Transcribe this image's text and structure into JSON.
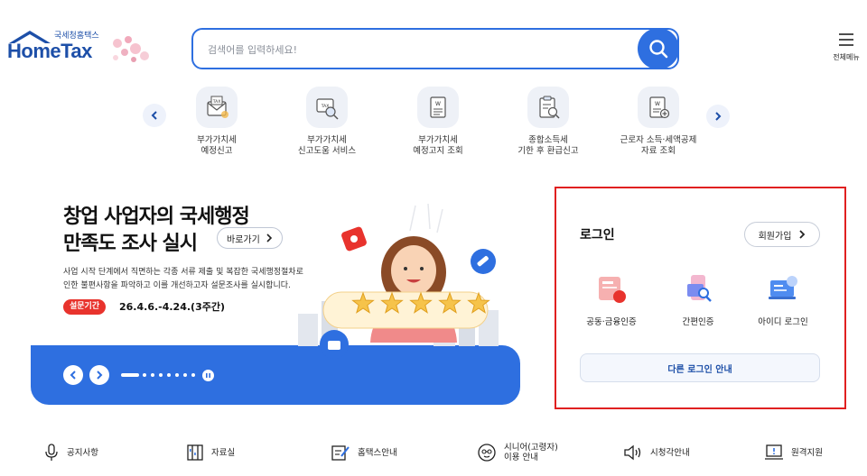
{
  "header": {
    "brand": "HomeTax",
    "brand_sub": "국세청홈택스",
    "search_placeholder": "검색어를 입력하세요!",
    "menu_label": "전체메뉴"
  },
  "quick_services": [
    {
      "line1": "부가가치세",
      "line2": "예정신고",
      "icon": "tax-envelope-icon"
    },
    {
      "line1": "부가가치세",
      "line2": "신고도움 서비스",
      "icon": "tax-search-icon"
    },
    {
      "line1": "부가가치세",
      "line2": "예정고지 조회",
      "icon": "won-document-icon"
    },
    {
      "line1": "종합소득세",
      "line2": "기한 후 환급신고",
      "icon": "clipboard-search-icon"
    },
    {
      "line1": "근로자 소득·세액공제",
      "line2": "자료 조회",
      "icon": "won-document-plus-icon"
    }
  ],
  "banner": {
    "title_line1": "창업 사업자의 국세행정",
    "title_line2": "만족도 조사 실시",
    "shortcut_label": "바로가기",
    "desc_line1": "사업 시작 단계에서 직면하는 각종 서류 제출 및 복잡한 국세행정절차로",
    "desc_line2": "인한 불편사항을 파악하고 이를 개선하고자 설문조사를 실시합니다.",
    "period_badge": "설문기간",
    "period_text": "26.4.6.-4.24.(3주간)",
    "slide_count": 8,
    "active_slide": 1
  },
  "login": {
    "title": "로그인",
    "signup_label": "회원가입",
    "methods": [
      {
        "label": "공동·금융인증",
        "icon": "certificate-icon"
      },
      {
        "label": "간편인증",
        "icon": "mobile-auth-icon"
      },
      {
        "label": "아이디 로그인",
        "icon": "id-login-icon"
      }
    ],
    "other_login_label": "다른 로그인 안내"
  },
  "bottom_links": [
    {
      "line1": "공지사항",
      "line2": "",
      "icon": "microphone-icon"
    },
    {
      "line1": "자료실",
      "line2": "",
      "icon": "folder-icon"
    },
    {
      "line1": "홈택스안내",
      "line2": "",
      "icon": "guide-pen-icon"
    },
    {
      "line1": "시니어(고령자)",
      "line2": "이용 안내",
      "icon": "senior-icon"
    },
    {
      "line1": "시청각안내",
      "line2": "",
      "icon": "speaker-icon"
    },
    {
      "line1": "원격지원",
      "line2": "",
      "icon": "remote-support-icon"
    }
  ],
  "colors": {
    "primary": "#2e6fe0",
    "brand": "#1d4fa8",
    "highlight_border": "#e02020",
    "badge_red": "#e8332d"
  }
}
